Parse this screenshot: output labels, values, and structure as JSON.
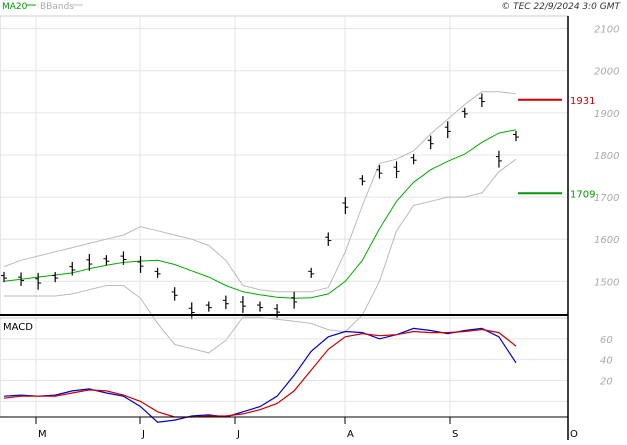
{
  "header": {
    "ma20_label": "MA20",
    "bbands_label": "BBands",
    "source": "© TEC 22/9/2024 3:0 GMT"
  },
  "chart_data": [
    {
      "type": "line",
      "panel": "price",
      "x_dates": [
        "M",
        "J",
        "J",
        "A",
        "S",
        "O"
      ],
      "y_ticks": [
        "2100",
        "2000",
        "1900",
        "1800",
        "1700",
        "1600",
        "1500"
      ],
      "ylim": [
        1420,
        2130
      ],
      "grid": true,
      "levels": [
        {
          "label": "1931",
          "value": 1931,
          "color": "#cc0000"
        },
        {
          "label": "1709",
          "value": 1709,
          "color": "#009900"
        }
      ],
      "series": [
        {
          "name": "MA20",
          "color": "#00aa00",
          "values": [
            1500,
            1505,
            1510,
            1515,
            1520,
            1530,
            1538,
            1545,
            1548,
            1550,
            1540,
            1525,
            1510,
            1490,
            1475,
            1468,
            1462,
            1460,
            1461,
            1470,
            1500,
            1550,
            1625,
            1690,
            1735,
            1765,
            1785,
            1802,
            1830,
            1852,
            1860
          ]
        },
        {
          "name": "BBands upper",
          "color": "#bbbbbb",
          "values": [
            1535,
            1550,
            1560,
            1570,
            1580,
            1590,
            1600,
            1610,
            1630,
            1620,
            1610,
            1600,
            1585,
            1550,
            1490,
            1480,
            1475,
            1475,
            1475,
            1485,
            1570,
            1680,
            1780,
            1790,
            1810,
            1850,
            1885,
            1920,
            1950,
            1950,
            1945
          ]
        },
        {
          "name": "BBands lower",
          "color": "#bbbbbb",
          "values": [
            1465,
            1465,
            1465,
            1465,
            1470,
            1480,
            1490,
            1490,
            1460,
            1400,
            1350,
            1340,
            1330,
            1360,
            1415,
            1415,
            1410,
            1405,
            1400,
            1385,
            1380,
            1420,
            1500,
            1620,
            1680,
            1690,
            1700,
            1700,
            1710,
            1760,
            1790
          ]
        },
        {
          "name": "Price",
          "color": "#000000",
          "values": [
            1510,
            1505,
            1500,
            1510,
            1530,
            1545,
            1550,
            1555,
            1540,
            1520,
            1470,
            1430,
            1440,
            1450,
            1445,
            1440,
            1430,
            1455,
            1520,
            1600,
            1680,
            1740,
            1760,
            1765,
            1790,
            1830,
            1860,
            1900,
            1930,
            1790,
            1845
          ]
        }
      ]
    },
    {
      "type": "line",
      "panel": "macd",
      "title": "MACD",
      "y_ticks": [
        "60",
        "40",
        "20"
      ],
      "ylim": [
        -15,
        80
      ],
      "grid": true,
      "series": [
        {
          "name": "MACD",
          "color": "#0000cc",
          "values": [
            5,
            6,
            5,
            6,
            10,
            12,
            8,
            5,
            -5,
            -20,
            -18,
            -14,
            -13,
            -15,
            -10,
            -5,
            5,
            25,
            48,
            62,
            67,
            66,
            60,
            64,
            70,
            68,
            65,
            68,
            70,
            62,
            37
          ]
        },
        {
          "name": "Signal",
          "color": "#cc0000",
          "values": [
            3,
            5,
            5,
            5,
            8,
            11,
            10,
            6,
            0,
            -10,
            -15,
            -15,
            -14,
            -14,
            -12,
            -8,
            -2,
            10,
            30,
            50,
            62,
            65,
            63,
            64,
            67,
            66,
            66,
            67,
            69,
            66,
            53
          ]
        }
      ]
    }
  ]
}
